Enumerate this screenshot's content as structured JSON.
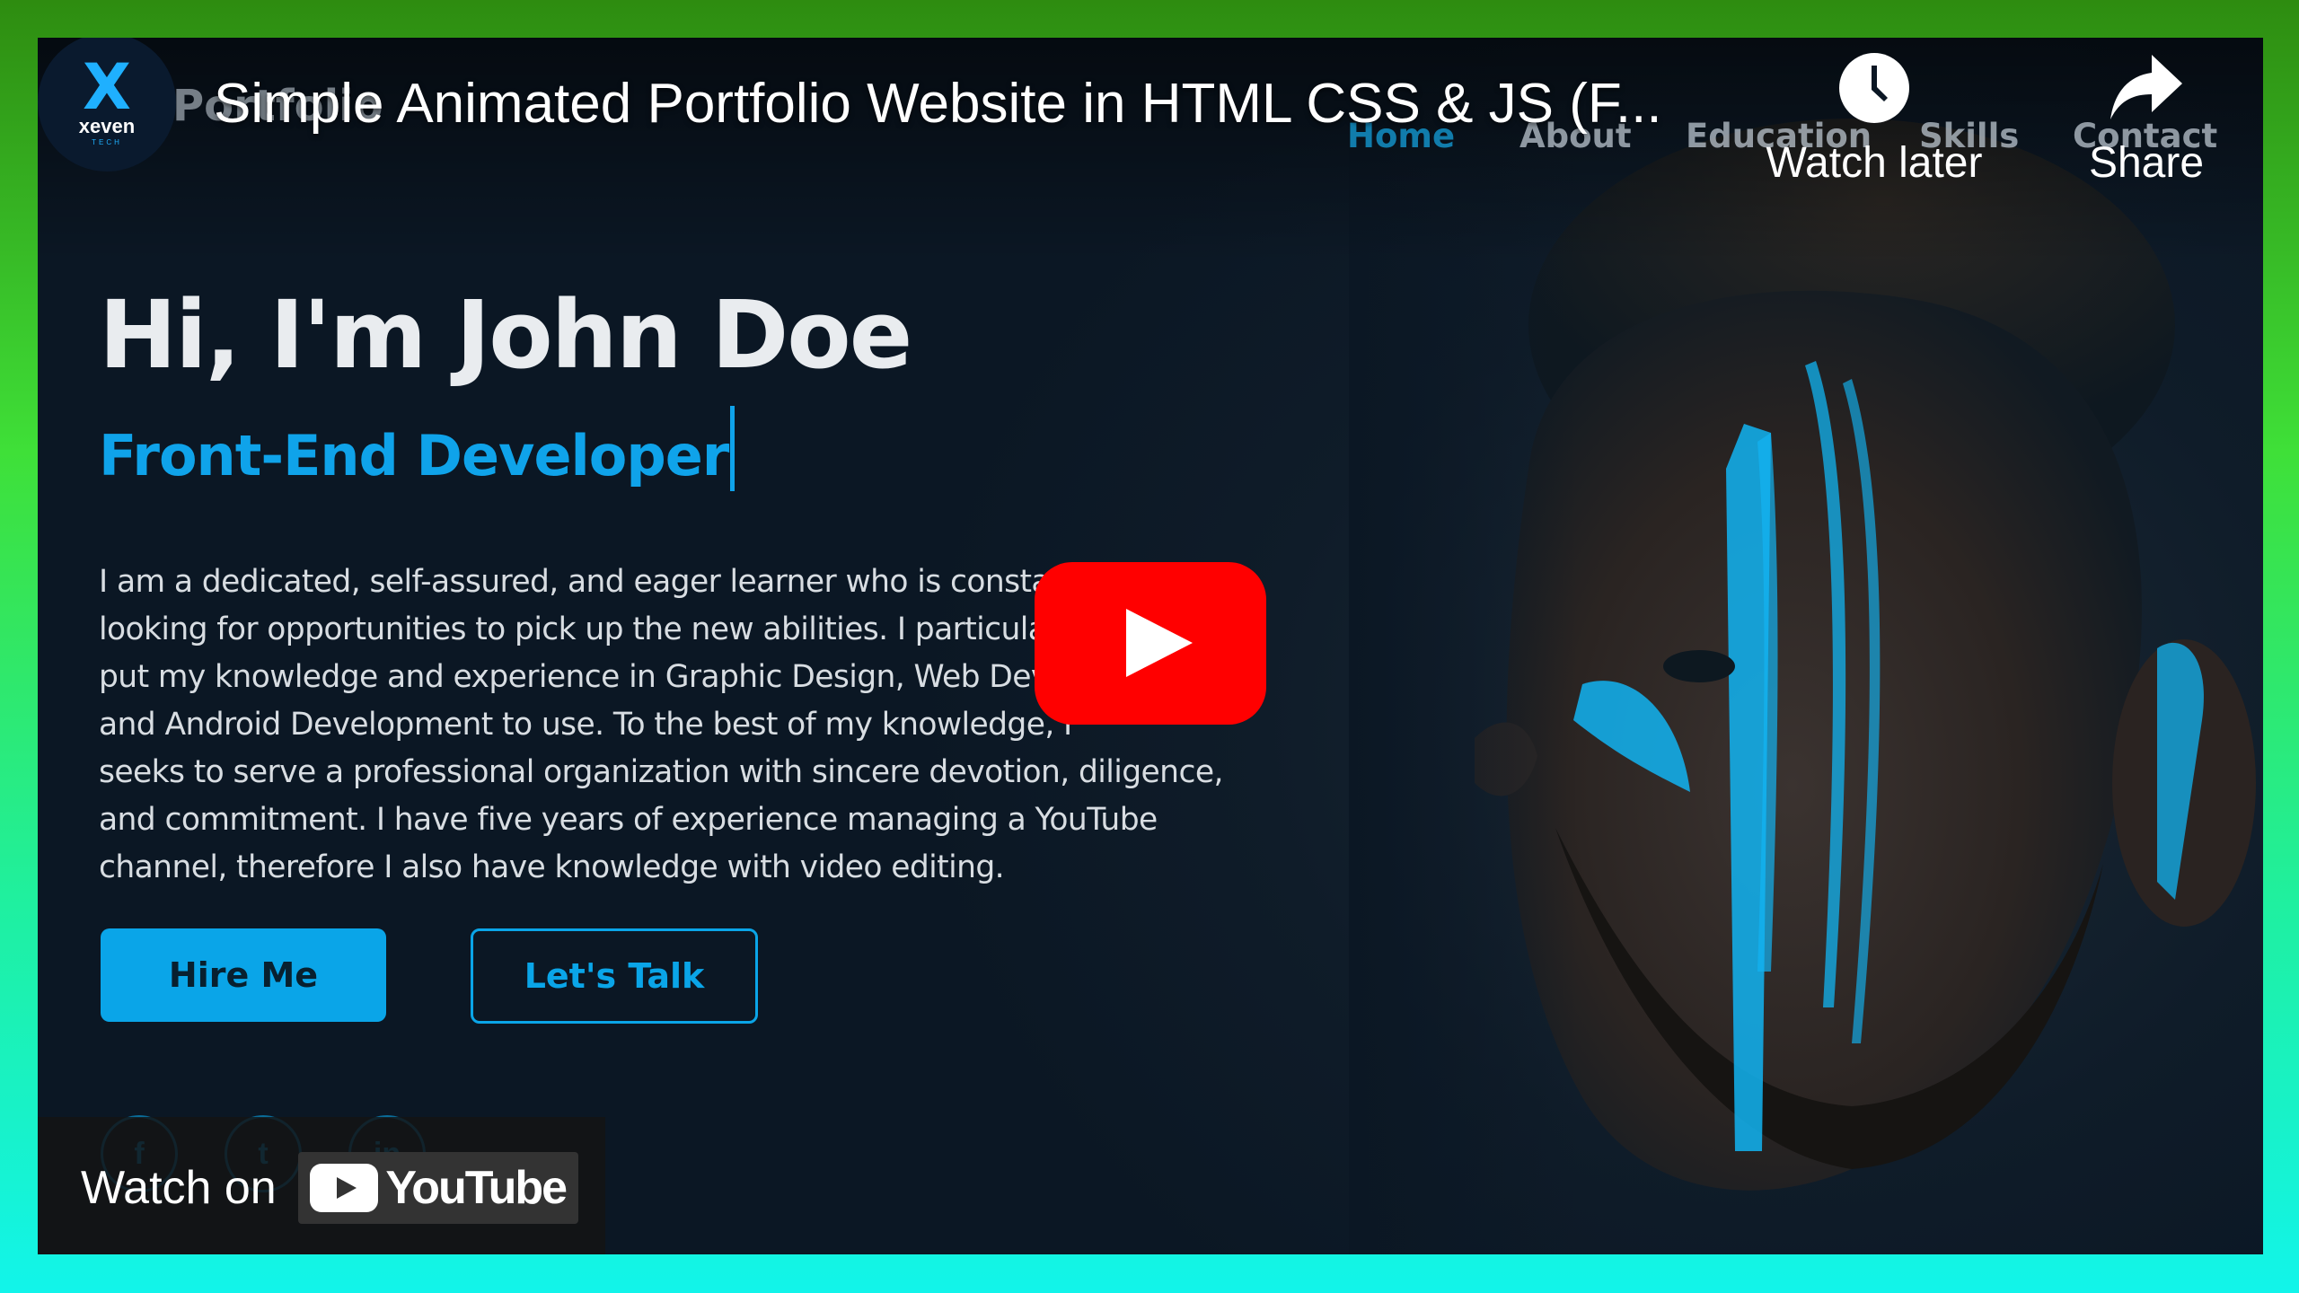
{
  "window": {
    "frame_colors": [
      "#2e8c10",
      "#3fe038",
      "#12f4ea"
    ]
  },
  "video": {
    "title": "Simple Animated Portfolio Website in HTML CSS & JS (F...",
    "channel_avatar": {
      "mark": "X",
      "name": "xeven",
      "sub": "TECH"
    },
    "actions": {
      "watch_later": "Watch later",
      "share": "Share"
    },
    "watch_on": {
      "label": "Watch on",
      "brand": "YouTube"
    }
  },
  "site": {
    "brand": "Portfolio",
    "nav": [
      "Home",
      "About",
      "Education",
      "Skills",
      "Contact"
    ],
    "hero": {
      "title": "Hi, I'm John Doe",
      "role": "Front-End Developer",
      "description_lines": [
        "I am a dedicated, self-assured, and eager learner who is constantly",
        "looking for opportunities to pick up the new abilities. I particularly",
        "put my knowledge and experience in Graphic Design, Web Development",
        "and Android Development to use. To the best of my knowledge, I",
        "seeks to serve a professional organization with sincere devotion, diligence,",
        "and commitment. I have five years of experience managing a YouTube",
        "channel, therefore I also have knowledge with video editing."
      ],
      "buttons": {
        "hire": "Hire Me",
        "talk": "Let's Talk"
      },
      "social": [
        "f",
        "t",
        "in"
      ]
    }
  },
  "colors": {
    "accent": "#0fa3ea",
    "background": "#0b1724",
    "youtube_red": "#ff0000"
  }
}
